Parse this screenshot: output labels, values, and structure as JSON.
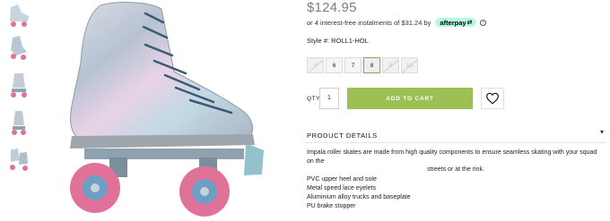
{
  "product": {
    "price": "$124.95",
    "instalments_text": "or 4 interest-free instalments of $31.24 by",
    "afterpay_label": "afterpay",
    "afterpay_arrow": "⇄",
    "info_icon_glyph": "i",
    "style_text": "Style #: ROLL1-HOL"
  },
  "sizes": [
    {
      "label": "5",
      "state": "unavailable"
    },
    {
      "label": "6",
      "state": "available"
    },
    {
      "label": "7",
      "state": "available"
    },
    {
      "label": "8",
      "state": "selected"
    },
    {
      "label": "9",
      "state": "unavailable"
    },
    {
      "label": "10",
      "state": "unavailable"
    }
  ],
  "cart": {
    "qty_label": "QTY",
    "qty_value": "1",
    "add_label": "ADD TO CART",
    "wishlist_icon": "heart-icon"
  },
  "details": {
    "heading": "PRODUCT DETAILS",
    "chevron": "▾",
    "description_line1": "Impala roller skates are made from high quality components to ensure seamless skating with your squad on the",
    "description_line2": "streets or at the rink.",
    "features": [
      "PVC upper heel and sole",
      "Metal speed lace eyelets",
      "Aluminium alloy trucks and baseplate",
      "PU brake stopper"
    ]
  },
  "colors": {
    "price": "#7d7d7d",
    "add_to_cart": "#9cc053",
    "afterpay_badge": "#b2fce4",
    "wheel": "#e0729a",
    "truck": "#7fa3b8"
  }
}
